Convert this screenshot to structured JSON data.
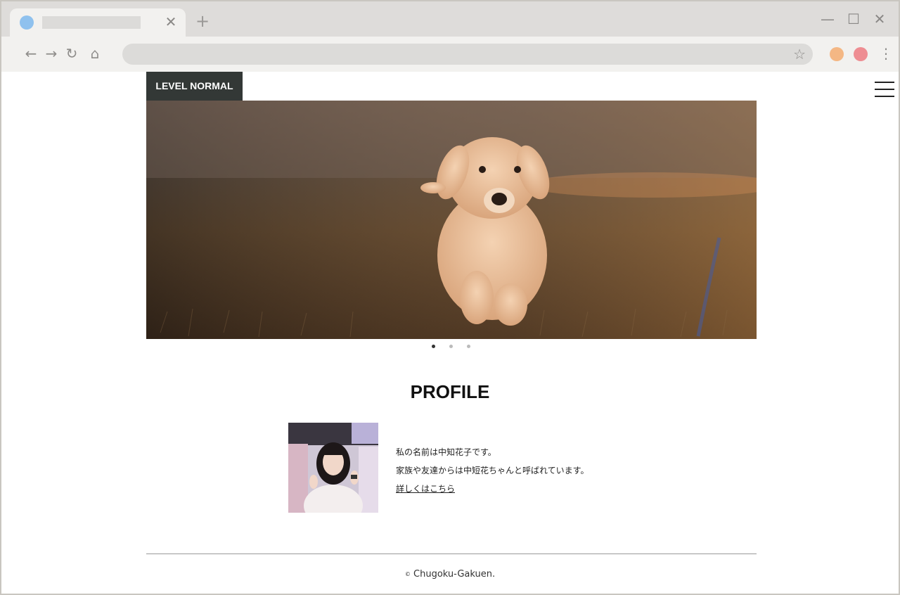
{
  "browser": {
    "tab_favicon_color": "#8fc1ee",
    "tab_close_glyph": "✕",
    "new_tab_glyph": "+",
    "window_controls": {
      "minimize": "—",
      "maximize": "☐",
      "close": "✕"
    },
    "nav": {
      "back": "←",
      "forward": "→",
      "reload": "↻",
      "home": "⌂"
    },
    "bookmark_star": "☆",
    "extension_colors": [
      "#f4b784",
      "#ee8d92"
    ],
    "menu_glyph": "⋮"
  },
  "site": {
    "logo_label": "LEVEL NORMAL",
    "menu_icon": "hamburger-icon",
    "hero": {
      "image": "golden-retriever-puppy-running-on-grass",
      "slide_count": 3,
      "active_slide": 1
    },
    "profile": {
      "heading": "PROFILE",
      "avatar_image": "woman-portrait-photo",
      "line1": "私の名前は中知花子です。",
      "line2": "家族や友達からは中短花ちゃんと呼ばれています。",
      "link": "詳しくはこちら"
    },
    "footer": {
      "copyright_symbol": "©",
      "copyright_text": "Chugoku-Gakuen."
    },
    "colors": {
      "logo_bg": "#333836",
      "dot_active": "#333333",
      "dot_inactive": "#bbbbbb"
    }
  }
}
